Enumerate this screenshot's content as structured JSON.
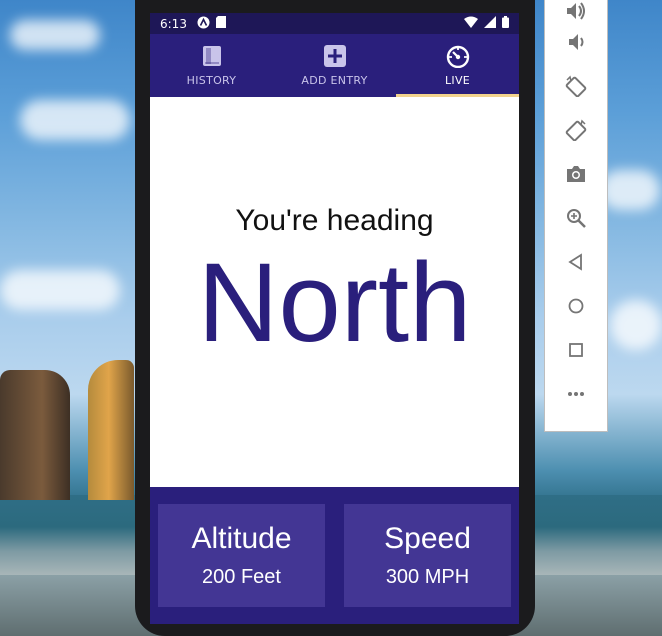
{
  "status_bar": {
    "time": "6:13",
    "icons": [
      "expo-icon",
      "sd-card-icon",
      "wifi-icon",
      "signal-icon",
      "battery-icon"
    ]
  },
  "tabs": [
    {
      "label": "HISTORY",
      "icon": "book-icon",
      "active": false
    },
    {
      "label": "ADD ENTRY",
      "icon": "plus-square-icon",
      "active": false
    },
    {
      "label": "LIVE",
      "icon": "speedometer-icon",
      "active": true
    }
  ],
  "live": {
    "heading_label": "You're heading",
    "direction": "North"
  },
  "stats": {
    "altitude": {
      "title": "Altitude",
      "value": "200 Feet"
    },
    "speed": {
      "title": "Speed",
      "value": "300 MPH"
    }
  },
  "emulator_toolbar": {
    "buttons": [
      "volume-up-icon",
      "volume-down-icon",
      "rotate-left-icon",
      "rotate-right-icon",
      "camera-icon",
      "zoom-icon",
      "back-icon",
      "home-icon",
      "overview-icon",
      "more-icon"
    ]
  },
  "colors": {
    "primary": "#2a1f7c",
    "status_bar": "#1e1757",
    "card": "#433694",
    "tab_indicator": "#f2d38d"
  }
}
